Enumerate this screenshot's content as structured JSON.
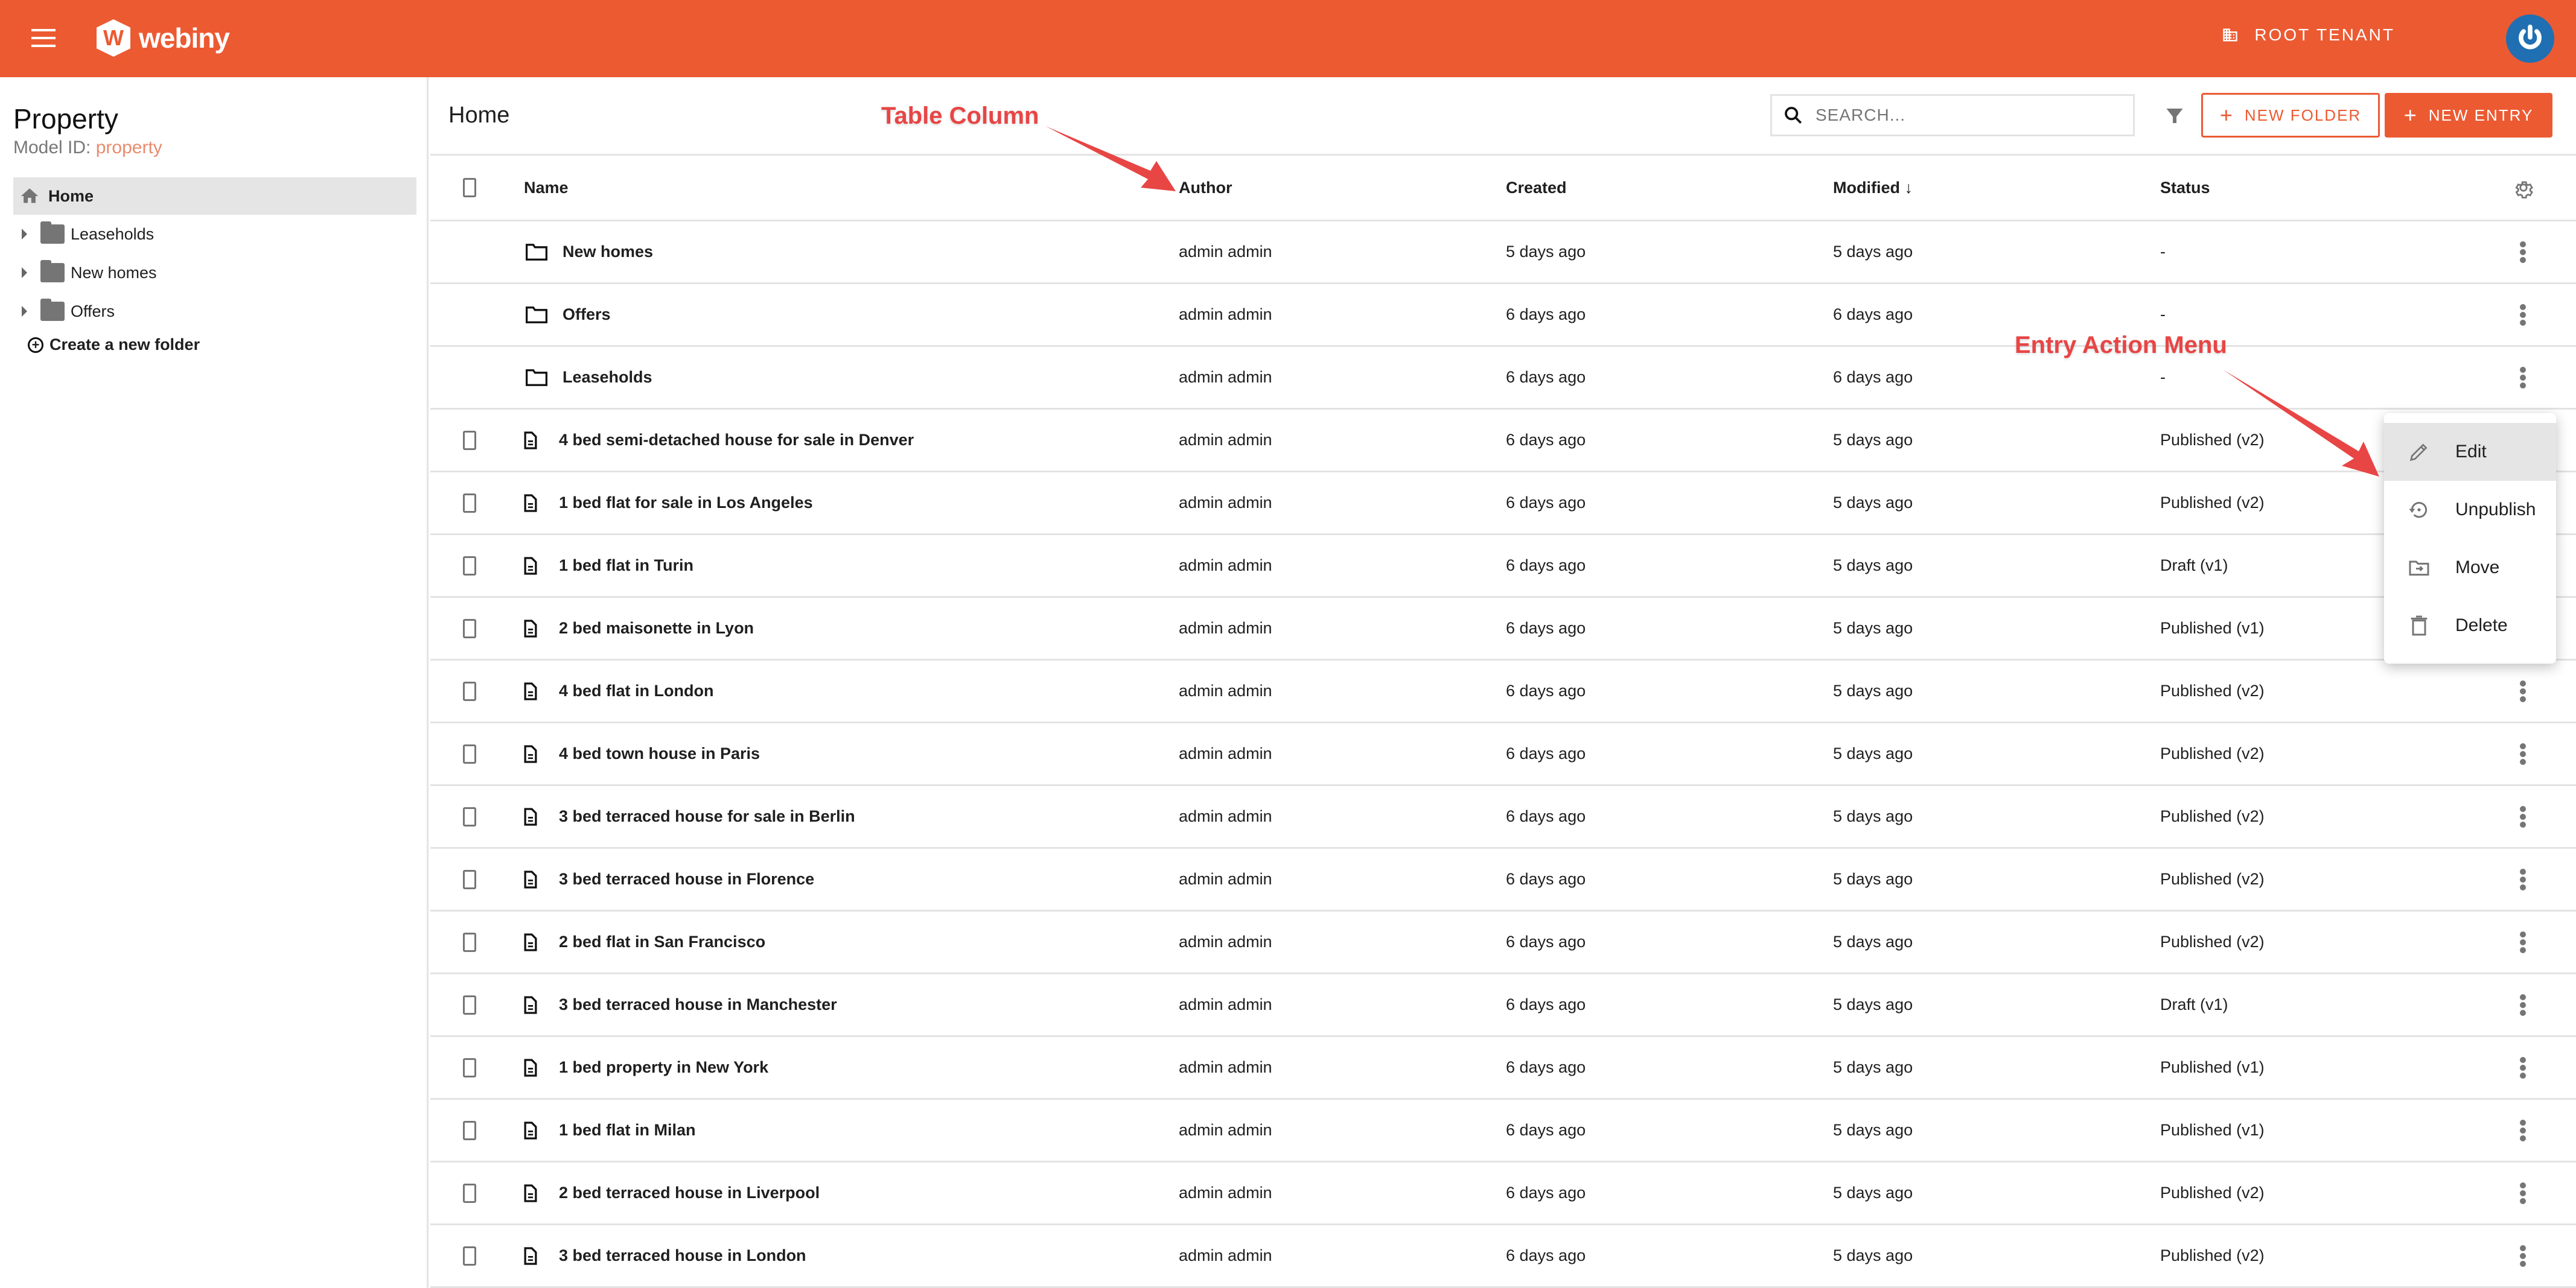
{
  "topbar": {
    "logo_text": "webiny",
    "logo_letter": "W",
    "tenant_label": "ROOT TENANT",
    "brand_color": "#ec5a32",
    "avatar_color": "#1f6fb2"
  },
  "sidebar": {
    "title": "Property",
    "model_id_label": "Model ID:",
    "model_id_value": "property",
    "home_label": "Home",
    "folders": [
      {
        "label": "Leaseholds"
      },
      {
        "label": "New homes"
      },
      {
        "label": "Offers"
      }
    ],
    "create_folder_label": "Create a new folder"
  },
  "main": {
    "title": "Home",
    "search_placeholder": "SEARCH...",
    "new_folder_label": "NEW FOLDER",
    "new_entry_label": "NEW ENTRY",
    "columns": {
      "name": "Name",
      "author": "Author",
      "created": "Created",
      "modified": "Modified",
      "modified_sort": "↓",
      "status": "Status"
    },
    "folder_rows": [
      {
        "name": "New homes",
        "author": "admin admin",
        "created": "5 days ago",
        "modified": "5 days ago",
        "status": "-"
      },
      {
        "name": "Offers",
        "author": "admin admin",
        "created": "6 days ago",
        "modified": "6 days ago",
        "status": "-"
      },
      {
        "name": "Leaseholds",
        "author": "admin admin",
        "created": "6 days ago",
        "modified": "6 days ago",
        "status": "-"
      }
    ],
    "entry_rows": [
      {
        "name": "4 bed semi-detached house for sale in Denver",
        "author": "admin admin",
        "created": "6 days ago",
        "modified": "5 days ago",
        "status": "Published (v2)"
      },
      {
        "name": "1 bed flat for sale in Los Angeles",
        "author": "admin admin",
        "created": "6 days ago",
        "modified": "5 days ago",
        "status": "Published (v2)"
      },
      {
        "name": "1 bed flat in Turin",
        "author": "admin admin",
        "created": "6 days ago",
        "modified": "5 days ago",
        "status": "Draft (v1)"
      },
      {
        "name": "2 bed maisonette in Lyon",
        "author": "admin admin",
        "created": "6 days ago",
        "modified": "5 days ago",
        "status": "Published (v1)"
      },
      {
        "name": "4 bed flat in London",
        "author": "admin admin",
        "created": "6 days ago",
        "modified": "5 days ago",
        "status": "Published (v2)"
      },
      {
        "name": "4 bed town house in Paris",
        "author": "admin admin",
        "created": "6 days ago",
        "modified": "5 days ago",
        "status": "Published (v2)"
      },
      {
        "name": "3 bed terraced house for sale in Berlin",
        "author": "admin admin",
        "created": "6 days ago",
        "modified": "5 days ago",
        "status": "Published (v2)"
      },
      {
        "name": "3 bed terraced house in Florence",
        "author": "admin admin",
        "created": "6 days ago",
        "modified": "5 days ago",
        "status": "Published (v2)"
      },
      {
        "name": "2 bed flat in San Francisco",
        "author": "admin admin",
        "created": "6 days ago",
        "modified": "5 days ago",
        "status": "Published (v2)"
      },
      {
        "name": "3 bed terraced house in Manchester",
        "author": "admin admin",
        "created": "6 days ago",
        "modified": "5 days ago",
        "status": "Draft (v1)"
      },
      {
        "name": "1 bed property in New York",
        "author": "admin admin",
        "created": "6 days ago",
        "modified": "5 days ago",
        "status": "Published (v1)"
      },
      {
        "name": "1 bed flat in Milan",
        "author": "admin admin",
        "created": "6 days ago",
        "modified": "5 days ago",
        "status": "Published (v1)"
      },
      {
        "name": "2 bed terraced house in Liverpool",
        "author": "admin admin",
        "created": "6 days ago",
        "modified": "5 days ago",
        "status": "Published (v2)"
      },
      {
        "name": "3 bed terraced house in London",
        "author": "admin admin",
        "created": "6 days ago",
        "modified": "5 days ago",
        "status": "Published (v2)"
      }
    ]
  },
  "action_menu": {
    "items": [
      {
        "label": "Edit",
        "icon": "pencil-icon",
        "active": true
      },
      {
        "label": "Unpublish",
        "icon": "unpublish-icon",
        "active": false
      },
      {
        "label": "Move",
        "icon": "move-folder-icon",
        "active": false
      },
      {
        "label": "Delete",
        "icon": "trash-icon",
        "active": false
      }
    ]
  },
  "annotations": {
    "table_column": "Table Column",
    "entry_action_menu": "Entry Action Menu",
    "color": "#e84545"
  }
}
